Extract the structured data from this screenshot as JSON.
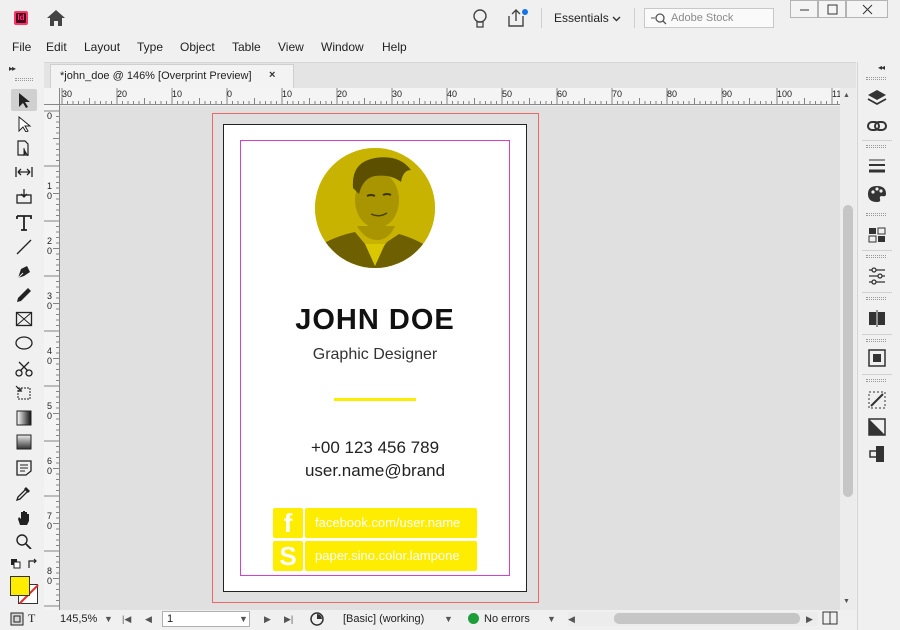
{
  "app": {
    "logo_text": "Id",
    "workspace": "Essentials",
    "stock_search_placeholder": "Adobe Stock",
    "brand_color": "#ff3366"
  },
  "menu": [
    "File",
    "Edit",
    "Layout",
    "Type",
    "Object",
    "Table",
    "View",
    "Window",
    "Help"
  ],
  "document_tab": {
    "title": "*john_doe @ 146% [Overprint Preview]",
    "close": "×"
  },
  "ruler": {
    "top_labels": [
      "30",
      "20",
      "10",
      "0",
      "10",
      "20",
      "30",
      "40",
      "50",
      "60",
      "70",
      "80",
      "90",
      "100",
      "11"
    ],
    "left_labels": [
      "0",
      "1 0",
      "2 0",
      "3 0",
      "4 0",
      "5 0",
      "6 0",
      "7 0",
      "8 0"
    ]
  },
  "card": {
    "name": "JOHN DOE",
    "role": "Graphic Designer",
    "phone": "+00 123 456 789",
    "email": "user.name@brand",
    "accent_color": "#ffed00",
    "social": [
      {
        "icon_letter": "f",
        "icon_name": "facebook-icon",
        "text": "facebook.com/user.name"
      },
      {
        "icon_letter": "S",
        "icon_name": "skype-icon",
        "text": "paper.sino.color.lampone"
      }
    ]
  },
  "status": {
    "zoom": "145,5%",
    "page": "1",
    "preflight_profile": "[Basic] (working)",
    "errors": "No errors",
    "ok_color": "#1e9e3a"
  }
}
